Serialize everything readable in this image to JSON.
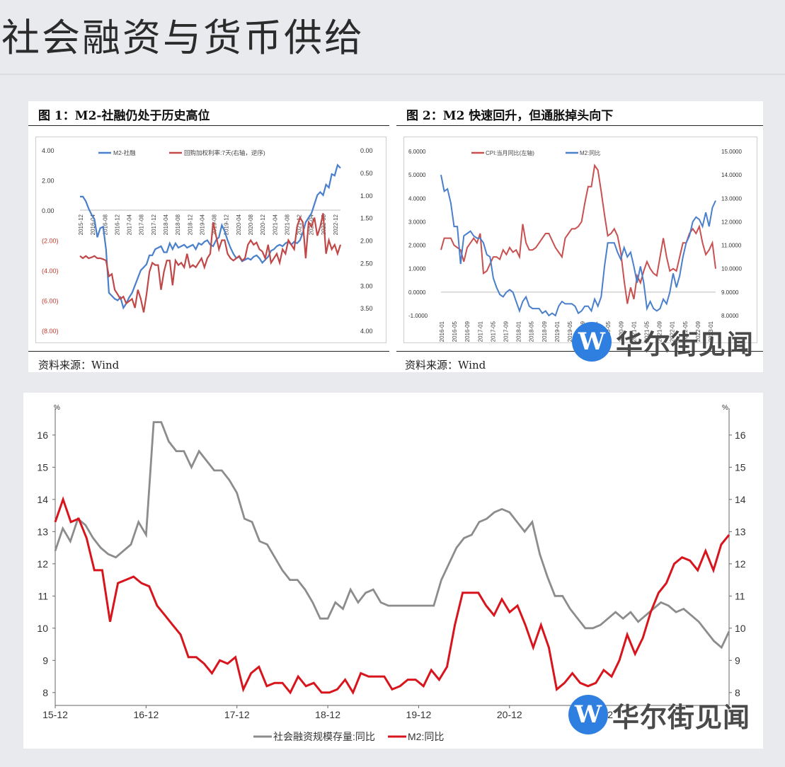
{
  "page": {
    "title": "社会融资与货币供给"
  },
  "watermark": {
    "logo_letter": "W",
    "text": "华尔街见闻"
  },
  "figure1": {
    "title": "图 1：M2-社融仍处于历史高位",
    "source": "资料来源：Wind"
  },
  "figure2": {
    "title": "图 2：M2 快速回升，但通胀掉头向下",
    "source": "资料来源：Wind"
  },
  "chart_data": [
    {
      "type": "line",
      "title": "图 1：M2-社融仍处于历史高位",
      "y_left_ticks": [
        "4.00",
        "2.00",
        "0.00",
        "(2.00)",
        "(4.00)",
        "(6.00)",
        "(8.00)"
      ],
      "y_right_ticks": [
        "0.00",
        "0.50",
        "1.00",
        "1.50",
        "2.00",
        "2.50",
        "3.00",
        "3.50",
        "4.00"
      ],
      "ylim_left": [
        -8,
        4
      ],
      "ylim_right_inverted": [
        0,
        4
      ],
      "x_ticks": [
        "2015-12",
        "2016-04",
        "2016-08",
        "2016-12",
        "2017-04",
        "2017-08",
        "2017-12",
        "2018-04",
        "2018-08",
        "2018-12",
        "2019-04",
        "2019-08",
        "2019-12",
        "2020-04",
        "2020-08",
        "2020-12",
        "2021-04",
        "2021-08",
        "2021-12",
        "2022-04",
        "2022-08",
        "2022-12"
      ],
      "series": [
        {
          "name": "M2-社融",
          "axis": "left",
          "color": "#4a7fcb",
          "values": [
            0.9,
            0.9,
            0.6,
            0.1,
            -0.3,
            -0.6,
            -1.8,
            -1.2,
            -1.1,
            -2.6,
            -5.5,
            -5.7,
            -5.9,
            -6.0,
            -5.8,
            -6.5,
            -6.2,
            -5.8,
            -5.5,
            -5.0,
            -4.5,
            -4.0,
            -3.8,
            -3.6,
            -3.0,
            -3.0,
            -2.6,
            -2.5,
            -2.4,
            -2.8,
            -2.8,
            -2.2,
            -2.6,
            -2.2,
            -2.5,
            -2.4,
            -2.3,
            -2.5,
            -2.4,
            -2.3,
            -2.6,
            -2.2,
            -2.3,
            -2.1,
            -2.0,
            -2.3,
            -2.4,
            -2.0,
            -1.8,
            -1.0,
            -1.4,
            -2.0,
            -2.5,
            -2.9,
            -3.2,
            -3.1,
            -3.4,
            -3.3,
            -3.2,
            -3.3,
            -3.1,
            -3.0,
            -3.2,
            -3.5,
            -3.3,
            -3.1,
            -2.7,
            -2.6,
            -2.4,
            -2.3,
            -2.4,
            -2.2,
            -2.1,
            -2.3,
            -2.1,
            -2.2,
            -2.0,
            -1.5,
            -0.8,
            -0.5,
            -0.2,
            0.4,
            1.0,
            1.2,
            1.0,
            1.7,
            1.5,
            2.4,
            2.3,
            3.0,
            2.8
          ]
        },
        {
          "name": "回购加权利率:7天(右轴，逆序)",
          "axis": "right",
          "color": "#c04848",
          "values": [
            2.35,
            2.4,
            2.35,
            2.4,
            2.38,
            2.35,
            2.4,
            2.4,
            2.42,
            2.45,
            2.8,
            2.75,
            3.1,
            3.2,
            3.3,
            3.25,
            3.4,
            3.35,
            3.3,
            3.5,
            3.1,
            3.3,
            3.6,
            3.2,
            2.7,
            2.5,
            2.55,
            2.55,
            3.1,
            2.7,
            2.45,
            2.45,
            3.0,
            2.45,
            2.55,
            2.5,
            2.6,
            2.3,
            2.6,
            2.55,
            2.6,
            2.5,
            2.4,
            2.6,
            2.4,
            2.3,
            1.6,
            1.9,
            2.2,
            2.0,
            2.0,
            2.3,
            2.4,
            2.45,
            2.4,
            2.35,
            2.45,
            2.4,
            2.1,
            2.0,
            2.1,
            2.05,
            2.2,
            2.25,
            2.4,
            2.1,
            2.5,
            2.4,
            2.3,
            2.5,
            2.2,
            2.3,
            2.0,
            2.1,
            2.2,
            1.7,
            1.5,
            1.6,
            2.4,
            1.6,
            1.7,
            1.5,
            1.9,
            1.7,
            1.4,
            2.3,
            2.0,
            2.2,
            2.1,
            2.3,
            2.1
          ]
        }
      ]
    },
    {
      "type": "line",
      "title": "图 2：M2 快速回升，但通胀掉头向下",
      "y_left_ticks": [
        "6.0000",
        "5.0000",
        "4.0000",
        "3.0000",
        "2.0000",
        "1.0000",
        "0.0000",
        "-1.0000"
      ],
      "y_right_ticks": [
        "15.0000",
        "14.0000",
        "13.0000",
        "12.0000",
        "11.0000",
        "10.0000",
        "9.0000",
        "8.0000"
      ],
      "ylim_left": [
        -1,
        6
      ],
      "ylim_right": [
        8,
        15
      ],
      "x_ticks": [
        "2016-01",
        "2016-05",
        "2016-09",
        "2017-01",
        "2017-05",
        "2017-09",
        "2018-01",
        "2018-05",
        "2018-09",
        "2019-01",
        "2019-05",
        "2019-09",
        "2020-01",
        "2020-05",
        "2020-09",
        "2021-01",
        "2021-05",
        "2021-09",
        "2022-01",
        "2022-05",
        "2022-09",
        "2023-01"
      ],
      "series": [
        {
          "name": "CPI:当月同比(左轴)",
          "axis": "left",
          "color": "#c85050",
          "values": [
            1.8,
            2.3,
            2.3,
            2.3,
            2.0,
            1.9,
            1.8,
            1.3,
            1.9,
            2.1,
            2.3,
            2.1,
            2.5,
            0.8,
            0.9,
            1.2,
            1.5,
            1.5,
            1.4,
            1.8,
            1.6,
            1.9,
            1.7,
            1.8,
            1.5,
            2.9,
            2.1,
            1.8,
            1.8,
            1.9,
            2.1,
            2.3,
            2.5,
            2.5,
            2.2,
            1.9,
            1.7,
            1.5,
            2.3,
            2.5,
            2.7,
            2.7,
            2.8,
            3.0,
            3.8,
            4.5,
            4.5,
            5.4,
            5.2,
            4.3,
            3.3,
            2.4,
            2.5,
            2.7,
            2.4,
            1.7,
            0.5,
            -0.5,
            0.2,
            -0.3,
            0.7,
            0.4,
            0.9,
            1.3,
            1.0,
            0.8,
            0.7,
            1.5,
            2.3,
            1.5,
            0.9,
            1.0,
            0.9,
            1.5,
            2.1,
            2.1,
            2.5,
            2.7,
            2.5,
            2.8,
            2.1,
            1.6,
            1.8,
            2.1,
            1.0
          ]
        },
        {
          "name": "M2:同比",
          "axis": "right",
          "color": "#4a7fcb",
          "values": [
            14.0,
            13.3,
            13.4,
            12.8,
            11.8,
            11.8,
            10.2,
            11.4,
            11.5,
            11.6,
            11.4,
            11.3,
            11.3,
            11.1,
            10.6,
            10.5,
            9.6,
            9.2,
            8.9,
            8.8,
            9.0,
            9.1,
            9.0,
            8.6,
            8.2,
            8.6,
            8.8,
            8.4,
            8.3,
            8.3,
            8.3,
            8.1,
            8.2,
            8.0,
            8.1,
            8.0,
            8.4,
            8.6,
            8.5,
            8.5,
            8.5,
            8.4,
            8.1,
            8.2,
            8.4,
            8.4,
            8.2,
            8.7,
            8.4,
            8.8,
            10.1,
            11.1,
            11.1,
            11.1,
            10.7,
            10.4,
            10.9,
            10.5,
            10.7,
            10.1,
            9.4,
            10.1,
            9.4,
            8.3,
            8.6,
            8.3,
            8.2,
            8.3,
            8.7,
            8.5,
            9.0,
            9.8,
            9.2,
            9.7,
            10.5,
            11.1,
            11.4,
            12.0,
            12.2,
            12.1,
            11.8,
            12.4,
            11.8,
            12.6,
            12.9
          ]
        }
      ]
    },
    {
      "type": "line",
      "y_ticks": [
        "8",
        "9",
        "10",
        "11",
        "12",
        "13",
        "14",
        "15",
        "16"
      ],
      "y_unit_left": "%",
      "y_unit_right": "%",
      "ylim": [
        7.6,
        16.7
      ],
      "x_ticks": [
        "15-12",
        "16-12",
        "17-12",
        "18-12",
        "19-12",
        "20-12",
        "21-12"
      ],
      "legend_position": "bottom",
      "series": [
        {
          "name": "社会融资规模存量:同比",
          "color": "#8c8c8c",
          "values": [
            12.4,
            13.1,
            12.7,
            13.4,
            13.2,
            12.8,
            12.5,
            12.3,
            12.2,
            12.4,
            12.6,
            13.3,
            12.9,
            16.4,
            16.4,
            15.8,
            15.5,
            15.5,
            15.0,
            15.5,
            15.2,
            14.9,
            14.9,
            14.6,
            14.2,
            13.4,
            13.3,
            12.7,
            12.6,
            12.2,
            11.8,
            11.5,
            11.5,
            11.2,
            10.8,
            10.3,
            10.3,
            10.8,
            10.6,
            11.2,
            10.8,
            11.1,
            11.2,
            10.8,
            10.7,
            10.7,
            10.7,
            10.7,
            10.7,
            10.7,
            10.7,
            11.5,
            12.0,
            12.5,
            12.8,
            12.9,
            13.3,
            13.4,
            13.6,
            13.7,
            13.6,
            13.3,
            13.0,
            13.3,
            12.3,
            11.6,
            11.0,
            11.0,
            10.6,
            10.3,
            10.0,
            10.0,
            10.1,
            10.3,
            10.5,
            10.3,
            10.5,
            10.2,
            10.4,
            10.6,
            10.8,
            10.7,
            10.5,
            10.6,
            10.4,
            10.2,
            9.9,
            9.6,
            9.4,
            9.9
          ]
        },
        {
          "name": "M2:同比",
          "color": "#d8141c",
          "values": [
            13.3,
            14.0,
            13.3,
            13.4,
            12.8,
            11.8,
            11.8,
            10.2,
            11.4,
            11.5,
            11.6,
            11.4,
            11.3,
            10.7,
            10.4,
            10.1,
            9.8,
            9.1,
            9.1,
            8.9,
            8.6,
            9.0,
            8.9,
            9.1,
            8.1,
            8.6,
            8.8,
            8.2,
            8.3,
            8.3,
            8.0,
            8.5,
            8.2,
            8.3,
            8.0,
            8.0,
            8.1,
            8.4,
            8.0,
            8.6,
            8.5,
            8.5,
            8.5,
            8.1,
            8.2,
            8.4,
            8.4,
            8.2,
            8.7,
            8.4,
            8.8,
            10.1,
            11.1,
            11.1,
            11.1,
            10.7,
            10.4,
            10.9,
            10.5,
            10.7,
            10.1,
            9.4,
            10.1,
            9.4,
            8.1,
            8.3,
            8.6,
            8.3,
            8.2,
            8.3,
            8.7,
            8.5,
            9.0,
            9.8,
            9.2,
            9.7,
            10.5,
            11.1,
            11.4,
            12.0,
            12.2,
            12.1,
            11.8,
            12.4,
            11.8,
            12.6,
            12.9
          ]
        }
      ]
    }
  ]
}
